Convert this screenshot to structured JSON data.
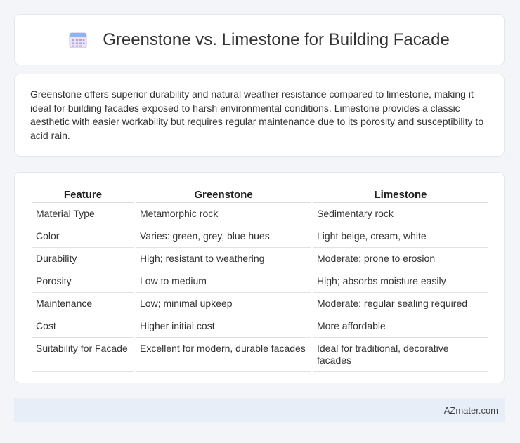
{
  "header": {
    "title": "Greenstone vs. Limestone for Building Facade",
    "icon": "calendar-icon"
  },
  "intro": {
    "text": "Greenstone offers superior durability and natural weather resistance compared to limestone, making it ideal for building facades exposed to harsh environmental conditions. Limestone provides a classic aesthetic with easier workability but requires regular maintenance due to its porosity and susceptibility to acid rain."
  },
  "table": {
    "headers": [
      "Feature",
      "Greenstone",
      "Limestone"
    ],
    "rows": [
      [
        "Material Type",
        "Metamorphic rock",
        "Sedimentary rock"
      ],
      [
        "Color",
        "Varies: green, grey, blue hues",
        "Light beige, cream, white"
      ],
      [
        "Durability",
        "High; resistant to weathering",
        "Moderate; prone to erosion"
      ],
      [
        "Porosity",
        "Low to medium",
        "High; absorbs moisture easily"
      ],
      [
        "Maintenance",
        "Low; minimal upkeep",
        "Moderate; regular sealing required"
      ],
      [
        "Cost",
        "Higher initial cost",
        "More affordable"
      ],
      [
        "Suitability for Facade",
        "Excellent for modern, durable facades",
        "Ideal for traditional, decorative facades"
      ]
    ]
  },
  "footer": {
    "brand": "AZmater.com"
  }
}
